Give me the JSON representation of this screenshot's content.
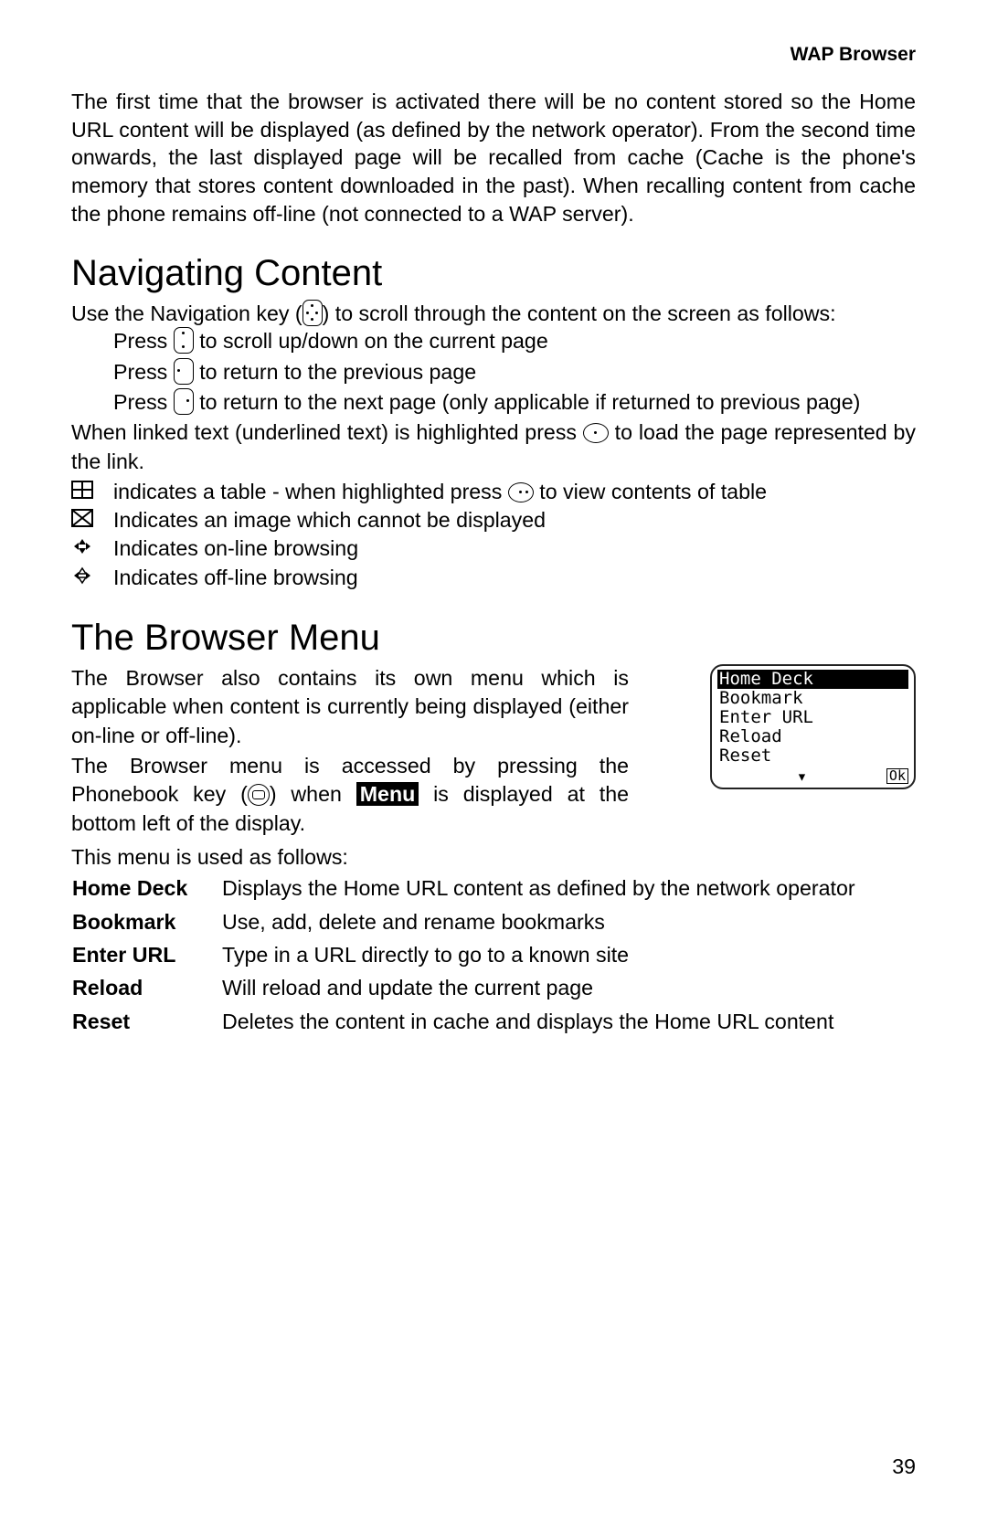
{
  "header": {
    "section": "WAP Browser"
  },
  "intro": "The first time that the browser is activated there will be no content stored so the Home URL content will be displayed (as defined by the network operator). From the second time onwards, the last displayed page will be recalled from cache (Cache is the phone's memory that stores content downloaded in the past). When recalling content from cache the phone remains off-line (not connected to a WAP server).",
  "nav": {
    "heading": "Navigating Content",
    "lead_a": "Use the Navigation key (",
    "lead_b": ") to scroll through the content on the screen as follows:",
    "press_word": "Press",
    "l1_after": " to scroll up/down on the current page",
    "l2_after": " to return to the previous page",
    "l3_after": " to return to the next page (only applicable if returned to previous page)",
    "linked_a": "When linked text (underlined text) is highlighted press ",
    "linked_b": " to load the page represented by the link.",
    "ind": [
      {
        "text": "indicates a table - when highlighted press ",
        "text_b": " to view contents of table"
      },
      {
        "text": "Indicates an image which cannot be displayed"
      },
      {
        "text": "Indicates on-line browsing"
      },
      {
        "text": "Indicates off-line browsing"
      }
    ]
  },
  "menu": {
    "heading": "The Browser Menu",
    "p1": "The Browser also contains its own menu which is applicable when content is currently being displayed (either on-line or off-line).",
    "p2a": "The Browser menu is accessed by pressing the Phonebook key (",
    "p2b": ") when ",
    "p2_menu": "Menu",
    "p2c": " is displayed at the bottom left of the display.",
    "p3": "This menu is used as follows:",
    "items": [
      {
        "k": "Home Deck",
        "v": "Displays the Home URL content as defined by the network operator"
      },
      {
        "k": "Bookmark",
        "v": "Use, add, delete and rename bookmarks"
      },
      {
        "k": "Enter URL",
        "v": "Type in a URL directly to go to a known site"
      },
      {
        "k": "Reload",
        "v": "Will reload and update the current page"
      },
      {
        "k": "Reset",
        "v": "Deletes the content in cache and displays the Home URL content"
      }
    ],
    "screen": {
      "items": [
        "Home Deck",
        "Bookmark",
        "Enter URL",
        "Reload",
        "Reset"
      ],
      "ok": "Ok"
    }
  },
  "page_number": "39"
}
